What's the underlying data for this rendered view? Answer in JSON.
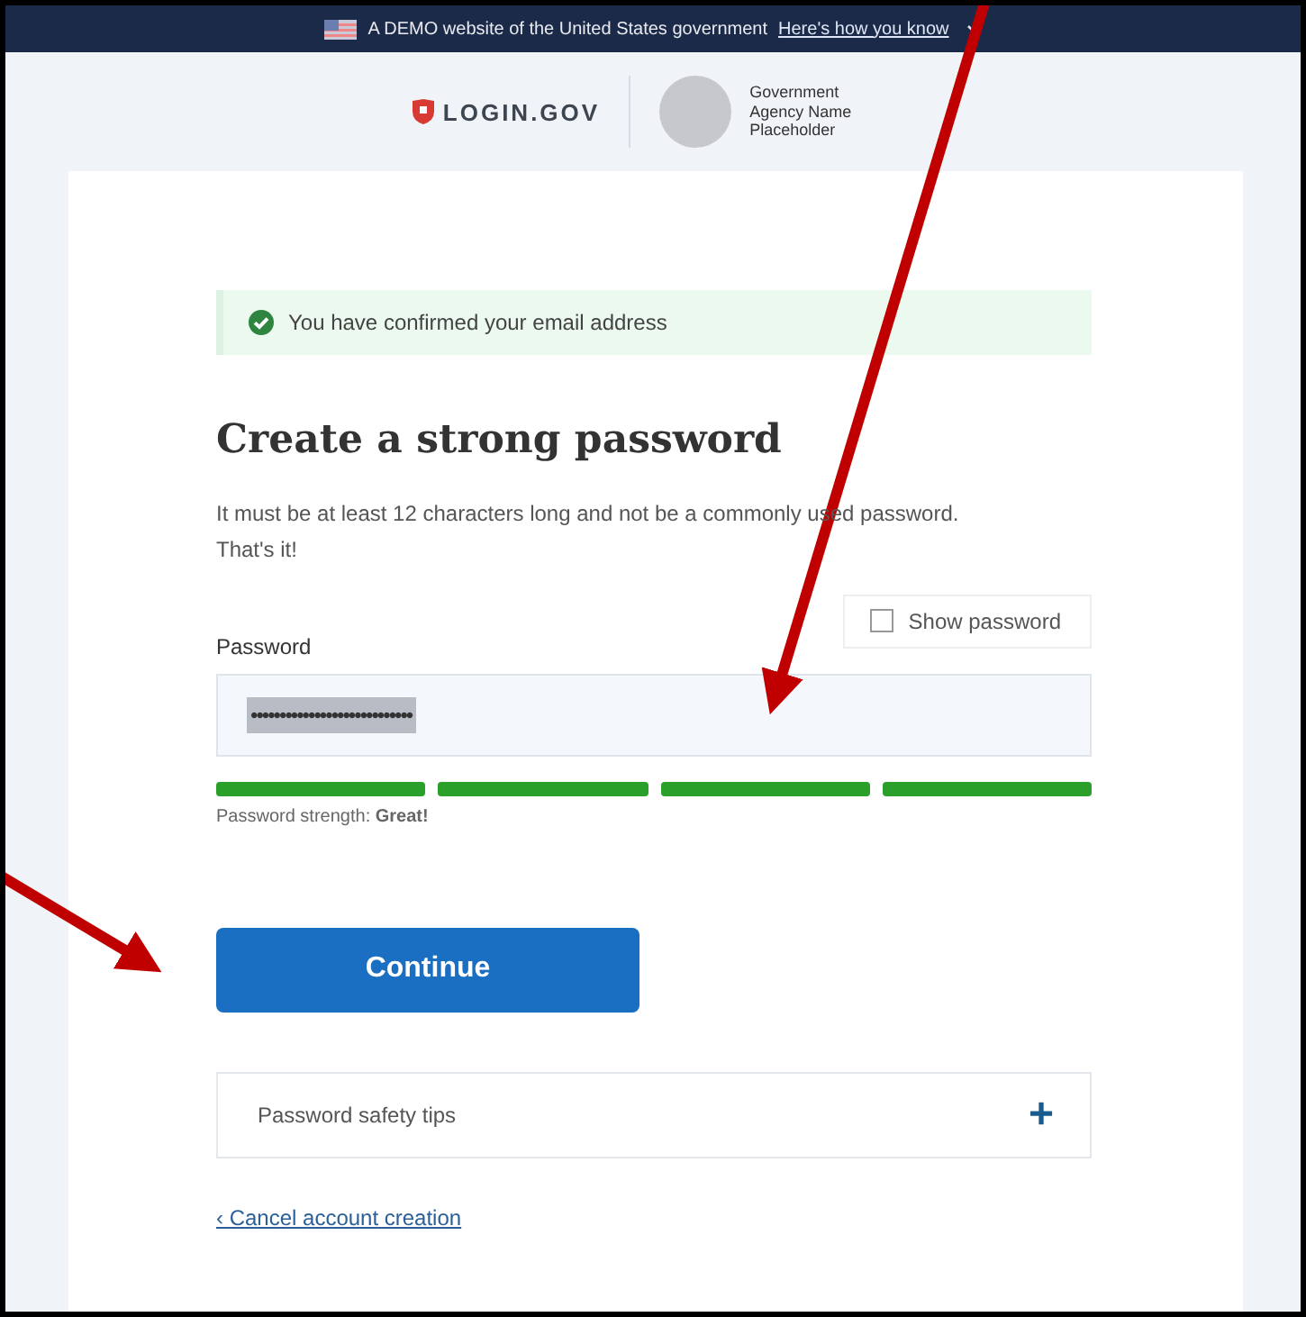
{
  "banner": {
    "text": "A DEMO website of the United States government",
    "link": "Here's how you know"
  },
  "header": {
    "logo": "LOGIN.GOV",
    "agency": "Government Agency Name Placeholder"
  },
  "alert": {
    "kind": "success",
    "text": "You have confirmed your email address"
  },
  "heading": "Create a strong password",
  "intro": "It must be at least 12 characters long and not be a commonly used password. That's it!",
  "show_password": {
    "label": "Show password",
    "checked": false
  },
  "password": {
    "label": "Password",
    "value": "••••••••••••••••••••••••••••",
    "value_selected": true
  },
  "strength_bars": [
    {
      "on": true
    },
    {
      "on": true
    },
    {
      "on": true
    },
    {
      "on": true
    }
  ],
  "strength_text": "Password strength: **Great!**",
  "continue_button": "Continue",
  "accordion": {
    "title": "Password safety tips",
    "expanded": false,
    "icon": "+"
  },
  "cancel_link": "‹ Cancel account creation"
}
